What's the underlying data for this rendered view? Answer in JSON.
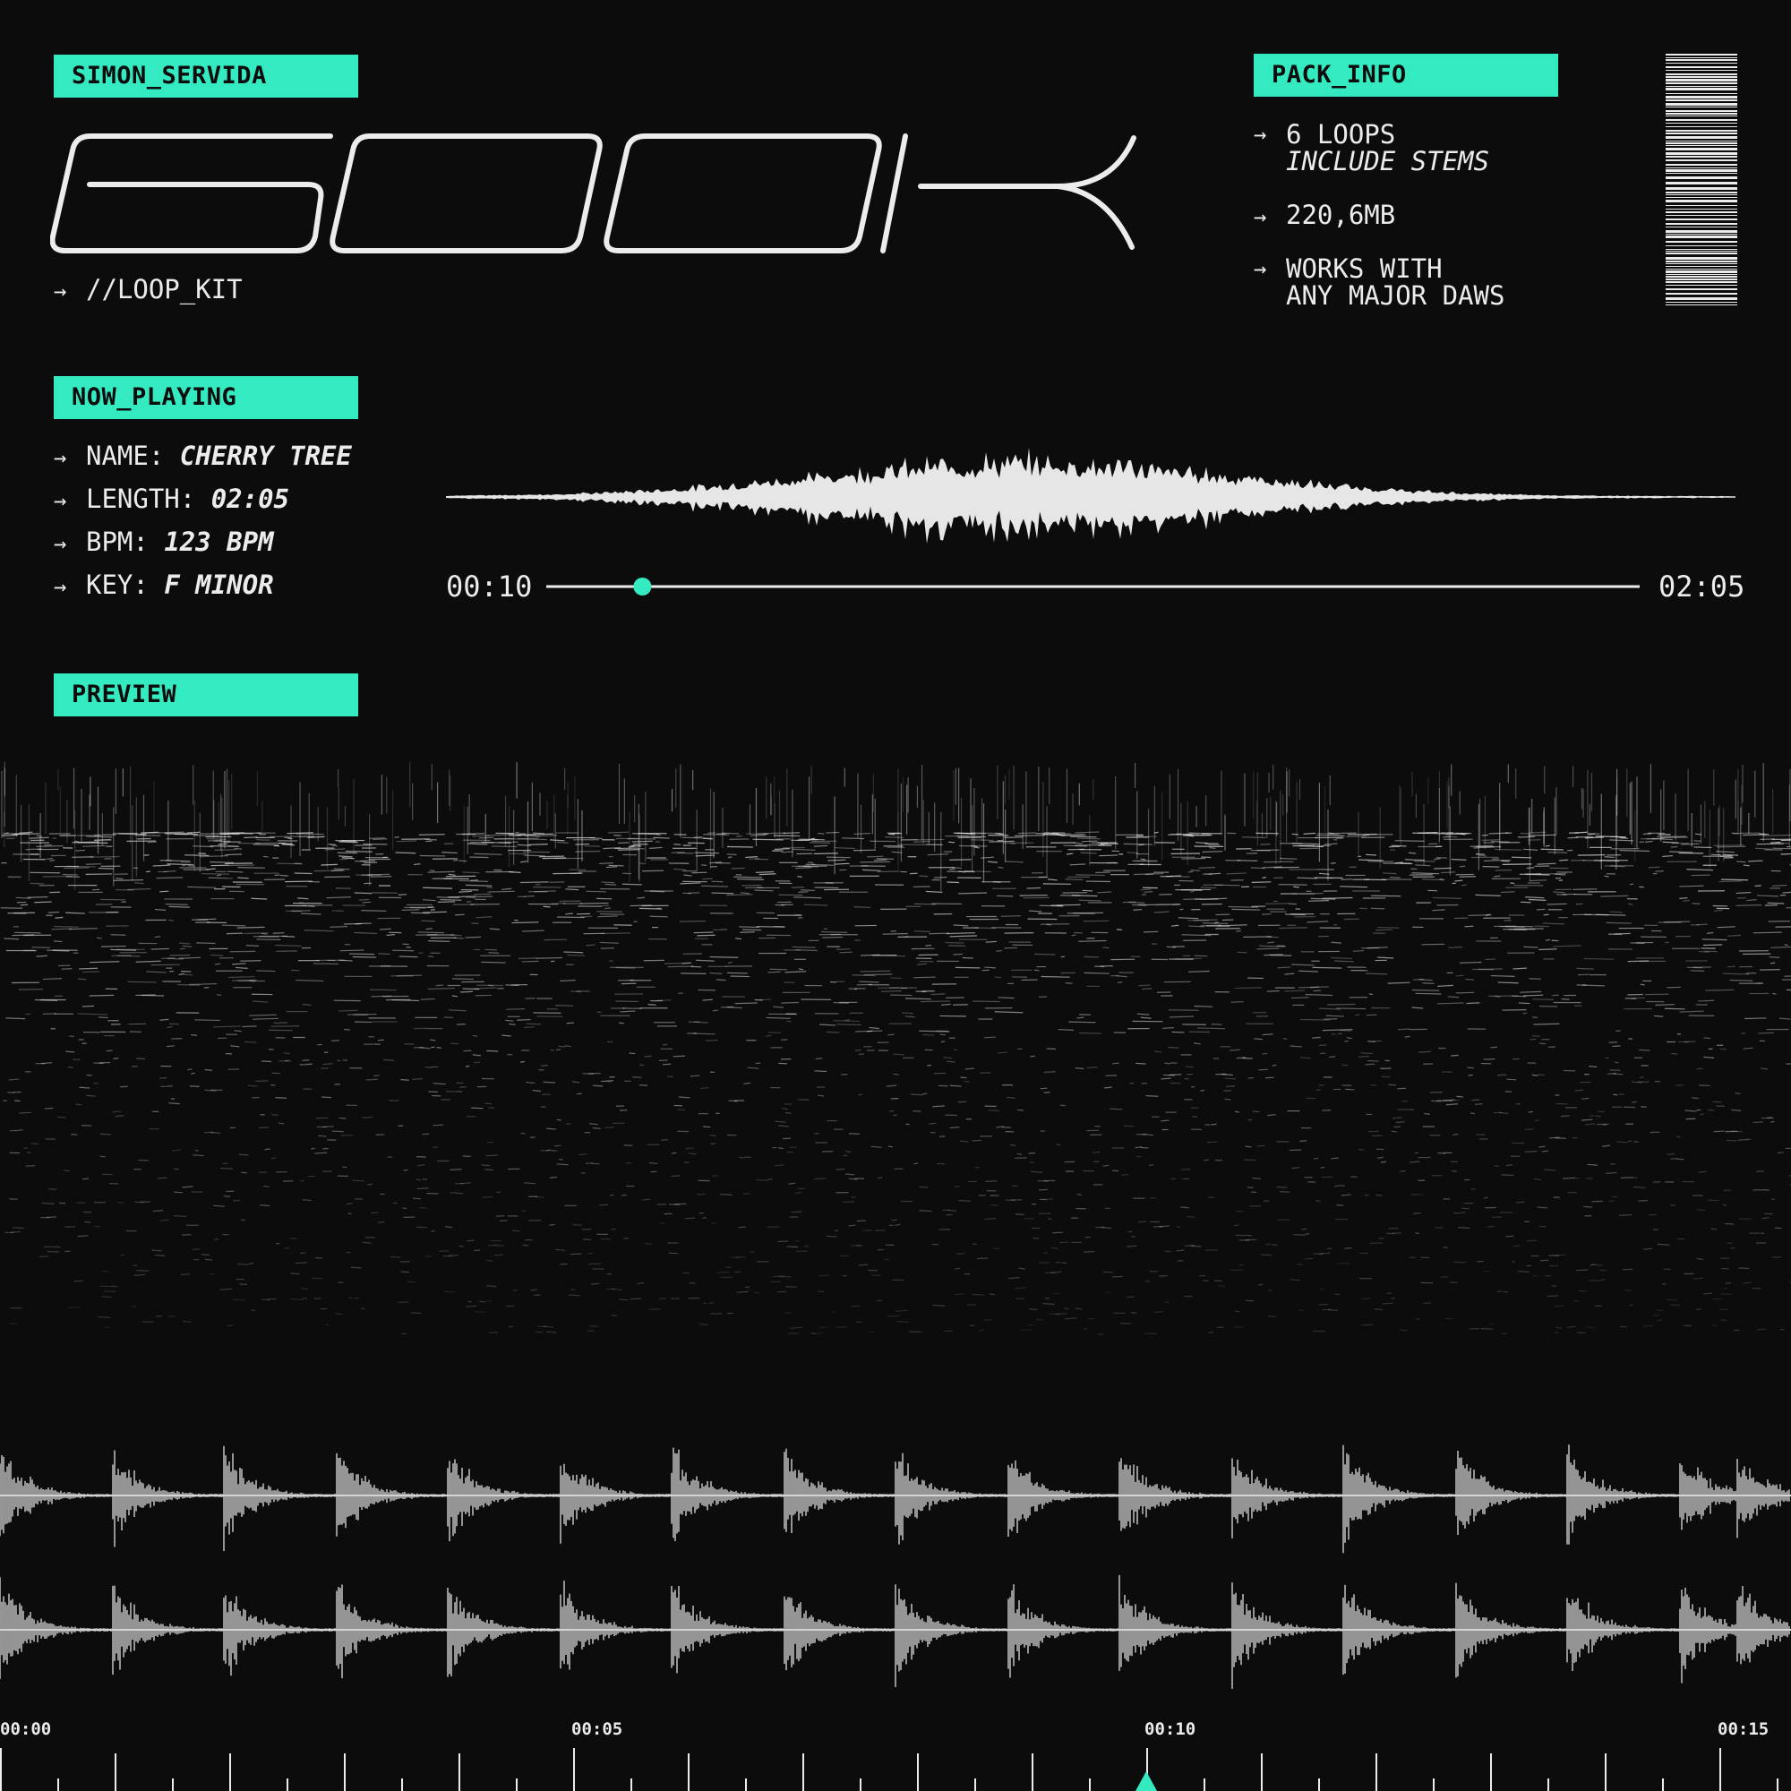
{
  "brand": {
    "artist": "SIMON_SERVIDA",
    "title": "600K",
    "subtitle": "//LOOP_KIT"
  },
  "pack_info": {
    "header": "PACK_INFO",
    "items": [
      {
        "line1": "6 LOOPS",
        "line2": "INCLUDE STEMS"
      },
      {
        "line1": "220,6MB",
        "line2": ""
      },
      {
        "line1": "WORKS WITH",
        "line2": "ANY MAJOR DAWS"
      }
    ]
  },
  "now_playing": {
    "header": "NOW_PLAYING",
    "fields": [
      {
        "label": "NAME:",
        "value": "CHERRY TREE"
      },
      {
        "label": "LENGTH:",
        "value": "02:05"
      },
      {
        "label": "BPM:",
        "value": "123 BPM"
      },
      {
        "label": "KEY:",
        "value": "F MINOR"
      }
    ],
    "current_time": "00:10",
    "total_time": "02:05",
    "progress": 0.088
  },
  "preview": {
    "header": "PREVIEW",
    "timeline_labels": [
      "00:00",
      "00:05",
      "00:10",
      "00:15"
    ],
    "playhead_seconds": 10
  },
  "icons": {
    "arrow": "arrow-right-icon",
    "barcode": "barcode-icon",
    "playhead": "playhead-triangle-icon"
  },
  "colors": {
    "accent": "#34ebc1",
    "background": "#0c0c0d",
    "foreground": "#ececec"
  }
}
